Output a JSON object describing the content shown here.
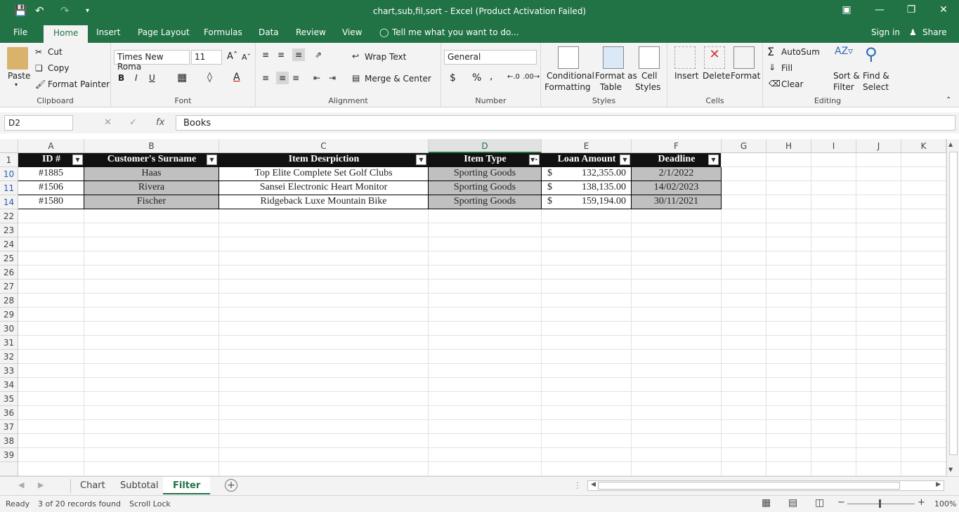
{
  "window": {
    "title": "chart,sub,fil,sort - Excel (Product Activation Failed)"
  },
  "ribbon_tabs": [
    "File",
    "Home",
    "Insert",
    "Page Layout",
    "Formulas",
    "Data",
    "Review",
    "View"
  ],
  "tell_me": "Tell me what you want to do...",
  "account": {
    "sign_in": "Sign in",
    "share": "Share"
  },
  "clipboard": {
    "paste": "Paste",
    "cut": "Cut",
    "copy": "Copy",
    "format_painter": "Format Painter",
    "label": "Clipboard"
  },
  "font": {
    "name": "Times New Roma",
    "size": "11",
    "label": "Font",
    "bold": "B",
    "italic": "I",
    "underline": "U"
  },
  "alignment": {
    "wrap": "Wrap Text",
    "merge": "Merge & Center",
    "label": "Alignment"
  },
  "number": {
    "format": "General",
    "label": "Number",
    "currency": "$",
    "percent": "%",
    "comma": ","
  },
  "styles": {
    "conditional": "Conditional",
    "formatting": "Formatting",
    "format_as": "Format as",
    "table": "Table",
    "cell": "Cell",
    "styles_word": "Styles",
    "label": "Styles"
  },
  "cells": {
    "insert": "Insert",
    "delete": "Delete",
    "format": "Format",
    "label": "Cells"
  },
  "editing": {
    "autosum": "AutoSum",
    "fill": "Fill",
    "clear": "Clear",
    "sort": "Sort &",
    "filter": "Filter",
    "find": "Find &",
    "select": "Select",
    "label": "Editing"
  },
  "formula_bar": {
    "name_box": "D2",
    "content": "Books",
    "fx": "fx"
  },
  "columns": [
    "A",
    "B",
    "C",
    "D",
    "E",
    "F",
    "G",
    "H",
    "I",
    "J",
    "K"
  ],
  "table": {
    "headers": [
      "ID #",
      "Customer's Surname",
      "Item Desrpiction",
      "Item Type",
      "Loan Amount",
      "Deadline"
    ],
    "rows": [
      {
        "row": "10",
        "id": "#1885",
        "surname": "Haas",
        "item": "Top Elite Complete Set Golf Clubs",
        "type": "Sporting Goods",
        "cur": "$",
        "amount": "132,355.00",
        "deadline": "2/1/2022"
      },
      {
        "row": "11",
        "id": "#1506",
        "surname": "Rivera",
        "item": "Sansei Electronic Heart Monitor",
        "type": "Sporting Goods",
        "cur": "$",
        "amount": "138,135.00",
        "deadline": "14/02/2023"
      },
      {
        "row": "14",
        "id": "#1580",
        "surname": "Fischer",
        "item": "Ridgeback Luxe Mountain Bike",
        "type": "Sporting Goods",
        "cur": "$",
        "amount": "159,194.00",
        "deadline": "30/11/2021"
      }
    ]
  },
  "row_numbers": [
    "1",
    "10",
    "11",
    "14",
    "22",
    "23",
    "24",
    "25",
    "26",
    "27",
    "28",
    "29",
    "30",
    "31",
    "32",
    "33",
    "34",
    "35",
    "36",
    "37",
    "38",
    "39"
  ],
  "sheets": [
    "Chart",
    "Subtotal",
    "Filter"
  ],
  "active_sheet": "Filter",
  "status": {
    "ready": "Ready",
    "records": "3 of 20 records found",
    "scroll_lock": "Scroll Lock",
    "zoom": "100%"
  },
  "colors": {
    "excel_green": "#217346",
    "header_black": "#111111",
    "filtered_gray": "#c0c0c0"
  }
}
